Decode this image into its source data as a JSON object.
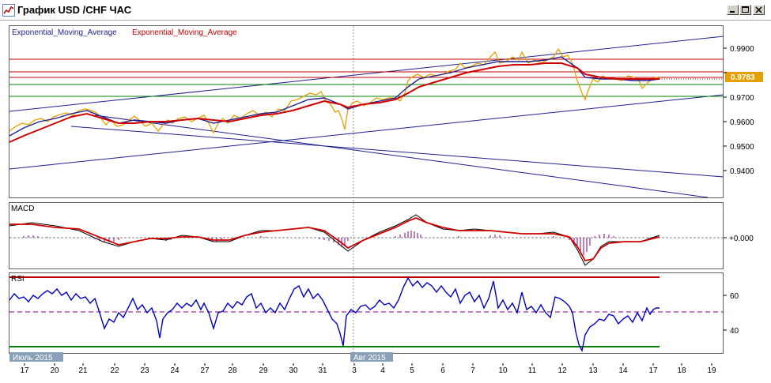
{
  "window": {
    "title": "График USD /CHF ЧАС",
    "controls": [
      "minimize",
      "maximize",
      "close"
    ]
  },
  "price_pane": {
    "indicator_labels": [
      "Exponential_Moving_Average",
      "Exponential_Moving_Average"
    ],
    "indicator_colors": [
      "#1f1f8f",
      "#c00000"
    ],
    "current_price": "0.9783",
    "price_ticks": [
      "0.9900",
      "0.9800",
      "0.9700",
      "0.9600",
      "0.9500",
      "0.9400"
    ]
  },
  "macd_pane": {
    "label": "MACD",
    "zero_label": "+0.000"
  },
  "rsi_pane": {
    "label": "RSI",
    "ticks": [
      "60",
      "40"
    ]
  },
  "time_axis": {
    "month_labels": [
      "Июль 2015",
      "Авг 2015"
    ],
    "day_labels": [
      "17",
      "20",
      "21",
      "22",
      "23",
      "24",
      "27",
      "28",
      "29",
      "30",
      "31",
      "3",
      "4",
      "5",
      "6",
      "7",
      "10",
      "11",
      "12",
      "13",
      "14",
      "17",
      "18",
      "19"
    ]
  },
  "colors": {
    "price": "#e8a000",
    "ema_fast": "#1f1f8f",
    "ema_slow": "#d00000",
    "channel": "#1f1f8f",
    "horiz_red": "#c00000",
    "horiz_green": "#008000",
    "rsi": "#0000c0",
    "macd_hist": "#800080"
  }
}
